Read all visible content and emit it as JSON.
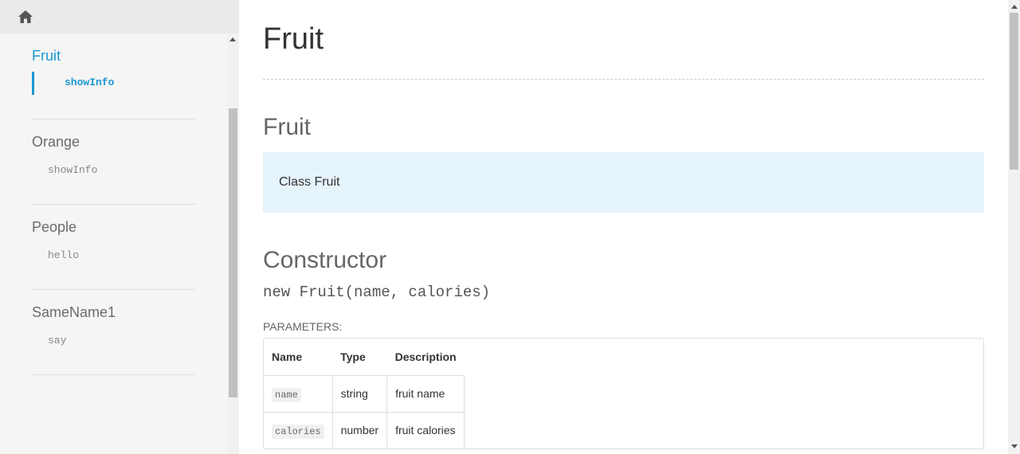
{
  "sidebar": {
    "sections": [
      {
        "title": "Fruit",
        "items": [
          "showInfo"
        ]
      },
      {
        "title": "Orange",
        "items": [
          "showInfo"
        ]
      },
      {
        "title": "People",
        "items": [
          "hello"
        ]
      },
      {
        "title": "SameName1",
        "items": [
          "say"
        ]
      }
    ]
  },
  "main": {
    "page_title": "Fruit",
    "class_heading": "Fruit",
    "class_description": "Class Fruit",
    "constructor_heading": "Constructor",
    "signature": "new Fruit(name, calories)",
    "params_label": "PARAMETERS:",
    "params_table": {
      "headers": [
        "Name",
        "Type",
        "Description"
      ],
      "rows": [
        [
          "name",
          "string",
          "fruit name"
        ],
        [
          "calories",
          "number",
          "fruit calories"
        ]
      ]
    }
  },
  "colors": {
    "accent": "#1b99d3",
    "description_bg": "#e6f4fb"
  },
  "icons": {
    "home": "home-icon"
  }
}
